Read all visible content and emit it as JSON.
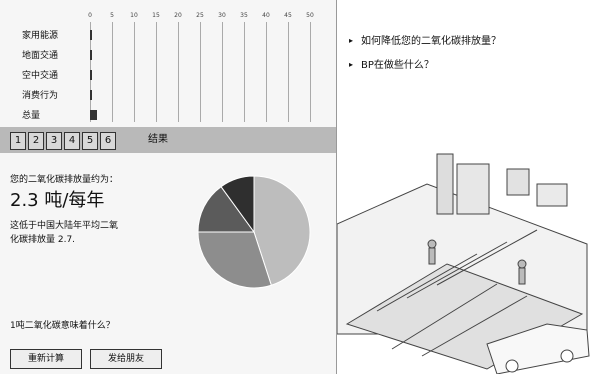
{
  "chart": {
    "ticks": [
      "0",
      "5",
      "10",
      "15",
      "20",
      "25",
      "30",
      "35",
      "40",
      "45",
      "50"
    ],
    "categories": [
      {
        "label": "家用能源",
        "bar_fraction": 0.006
      },
      {
        "label": "地面交通",
        "bar_fraction": 0.005
      },
      {
        "label": "空中交通",
        "bar_fraction": 0.004
      },
      {
        "label": "消费行为",
        "bar_fraction": 0.003
      },
      {
        "label": "总量",
        "bar_fraction": 0.03
      }
    ]
  },
  "steps": {
    "items": [
      "1",
      "2",
      "3",
      "4",
      "5",
      "6"
    ],
    "result_label": "结果"
  },
  "result": {
    "emission_label": "您的二氧化碳排放量约为：",
    "emission_value": "2.3 吨/每年",
    "comparison_text_line1": "这低于中国大陆年平均二氧",
    "comparison_text_line2": "化碳排放量 2.7."
  },
  "question_left": "1吨二氧化碳意味着什么？",
  "buttons": {
    "recalculate": "重新计算",
    "send_friend": "发给朋友"
  },
  "right": {
    "q1": "如何降低您的二氧化碳排放量？",
    "q2": "BP在做些什么？"
  },
  "chart_data": {
    "type": "pie",
    "values": [
      0.45,
      0.3,
      0.15,
      0.1
    ],
    "colors": [
      "#bdbdbd",
      "#8d8d8d",
      "#5b5b5b",
      "#2f2f2f"
    ]
  }
}
